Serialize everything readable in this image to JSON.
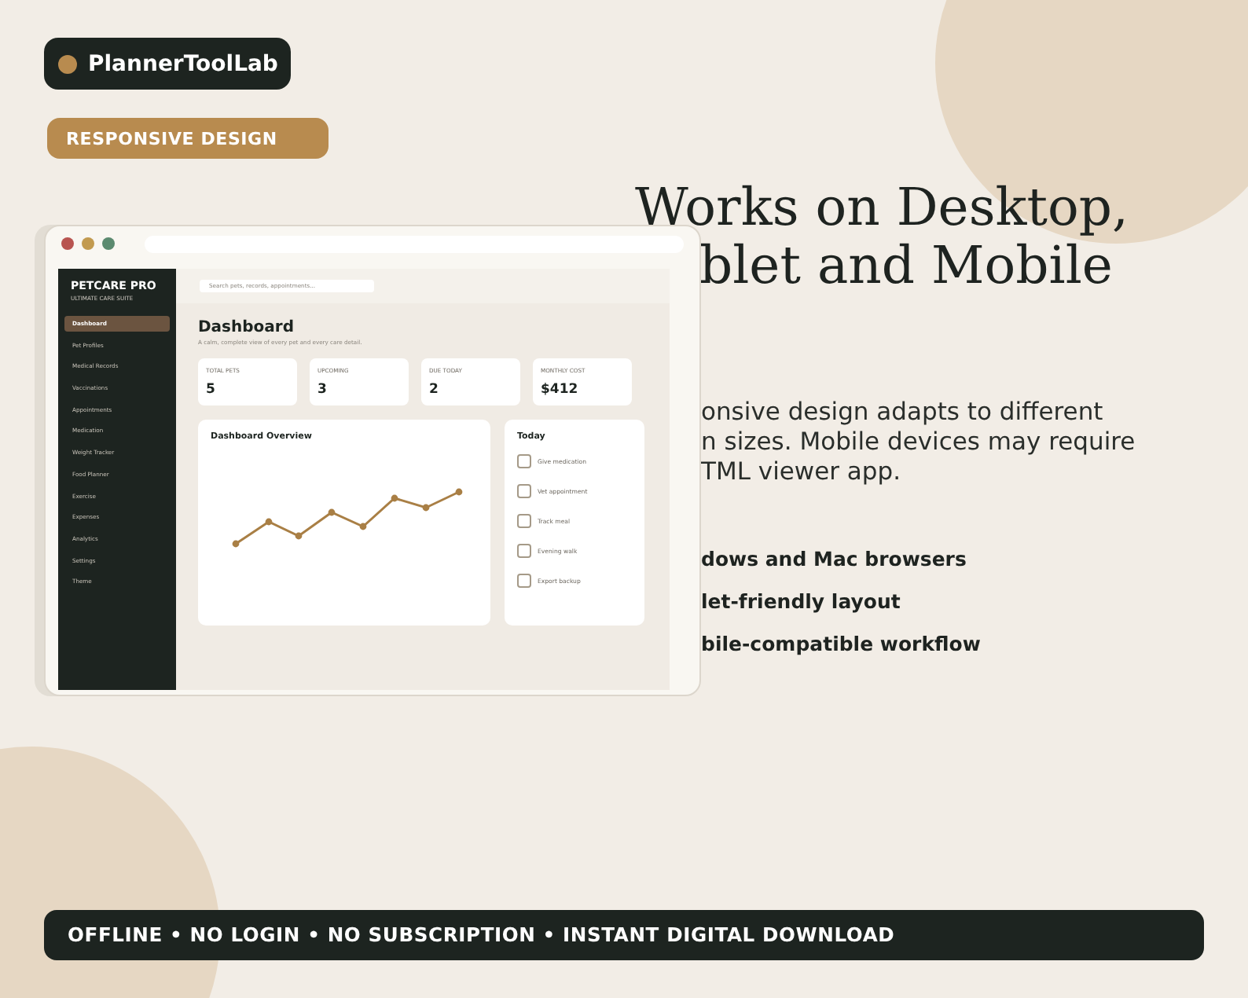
{
  "brand": {
    "name": "PlannerToolLab"
  },
  "badge": "RESPONSIVE DESIGN",
  "mockup": {
    "app_title": "PETCARE PRO",
    "app_subtitle": "ULTIMATE CARE SUITE",
    "sidebar": {
      "items": [
        {
          "label": "Dashboard",
          "selected": true
        },
        {
          "label": "Pet Profiles",
          "selected": false
        },
        {
          "label": "Medical Records",
          "selected": false
        },
        {
          "label": "Vaccinations",
          "selected": false
        },
        {
          "label": "Appointments",
          "selected": false
        },
        {
          "label": "Medication",
          "selected": false
        },
        {
          "label": "Weight Tracker",
          "selected": false
        },
        {
          "label": "Food Planner",
          "selected": false
        },
        {
          "label": "Exercise",
          "selected": false
        },
        {
          "label": "Expenses",
          "selected": false
        },
        {
          "label": "Analytics",
          "selected": false
        },
        {
          "label": "Settings",
          "selected": false
        },
        {
          "label": "Theme",
          "selected": false
        }
      ]
    },
    "search": {
      "placeholder": "Search pets, records, appointments..."
    },
    "page_title": "Dashboard",
    "page_subtitle": "A calm, complete view of every pet and every care detail.",
    "stats": [
      {
        "label": "TOTAL PETS",
        "value": "5"
      },
      {
        "label": "UPCOMING",
        "value": "3"
      },
      {
        "label": "DUE TODAY",
        "value": "2"
      },
      {
        "label": "MONTHLY COST",
        "value": "$412"
      }
    ],
    "overview": {
      "title": "Dashboard Overview"
    },
    "today": {
      "title": "Today",
      "tasks": [
        {
          "label": "Give medication",
          "checked": false
        },
        {
          "label": "Vet appointment",
          "checked": false
        },
        {
          "label": "Track meal",
          "checked": false
        },
        {
          "label": "Evening walk",
          "checked": false
        },
        {
          "label": "Export backup",
          "checked": false
        }
      ]
    }
  },
  "headline": [
    "Works on Desktop,",
    "blet and Mobile"
  ],
  "description": [
    "onsive design adapts to different",
    "n sizes. Mobile devices may require",
    "TML viewer app."
  ],
  "features": [
    "dows and Mac browsers",
    "let-friendly layout",
    "bile-compatible workflow"
  ],
  "footer": "OFFLINE • NO LOGIN • NO SUBSCRIPTION • INSTANT DIGITAL DOWNLOAD"
}
